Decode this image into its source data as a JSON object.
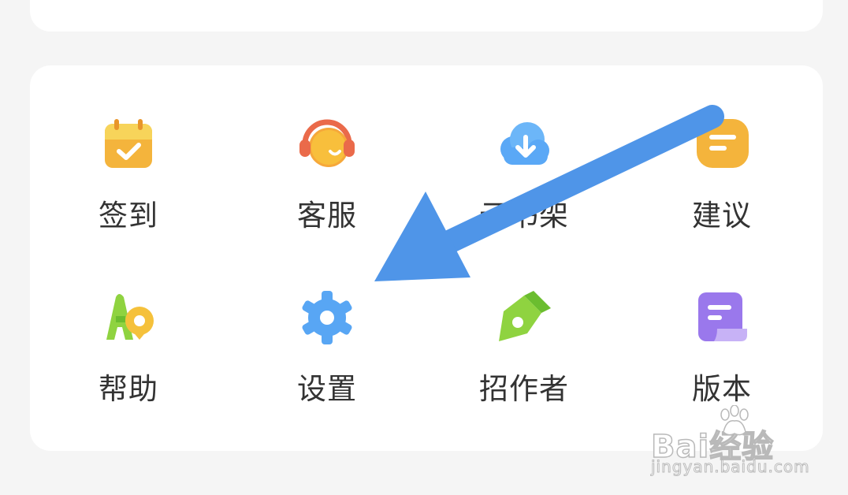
{
  "menu": {
    "items": [
      {
        "label": "签到",
        "icon": "calendar-check-icon"
      },
      {
        "label": "客服",
        "icon": "headset-icon"
      },
      {
        "label": "云书架",
        "icon": "cloud-download-icon"
      },
      {
        "label": "建议",
        "icon": "message-icon"
      },
      {
        "label": "帮助",
        "icon": "help-icon"
      },
      {
        "label": "设置",
        "icon": "gear-icon"
      },
      {
        "label": "招作者",
        "icon": "pen-nib-icon"
      },
      {
        "label": "版本",
        "icon": "document-icon"
      }
    ]
  },
  "annotation": {
    "color": "#4f95e8",
    "points_to": "settings"
  },
  "watermark": {
    "brand": "Bai经验",
    "site": "jingyan.baidu.com"
  },
  "colors": {
    "background": "#f5f5f5",
    "card": "#ffffff",
    "label": "#333333"
  }
}
